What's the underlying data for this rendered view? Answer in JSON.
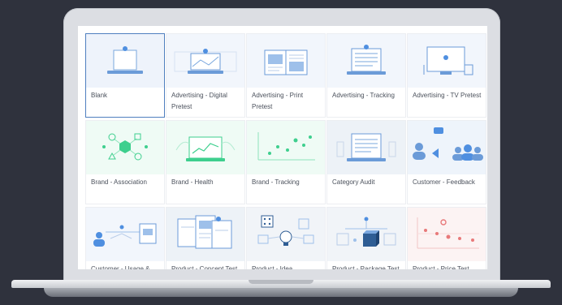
{
  "templates": [
    {
      "label": "Blank",
      "icon": "blank-laptop-icon",
      "bg": "#eef3fb"
    },
    {
      "label": "Advertising - Digital Pretest",
      "icon": "digital-pretest-icon",
      "bg": "#f2f6fc"
    },
    {
      "label": "Advertising - Print Pretest",
      "icon": "print-pretest-icon",
      "bg": "#f2f6fc"
    },
    {
      "label": "Advertising - Tracking",
      "icon": "ad-tracking-icon",
      "bg": "#f2f6fc"
    },
    {
      "label": "Advertising - TV Pretest",
      "icon": "tv-pretest-icon",
      "bg": "#f2f6fc"
    },
    {
      "label": "Brand - Association",
      "icon": "brand-association-icon",
      "bg": "#effbf5"
    },
    {
      "label": "Brand - Health",
      "icon": "brand-health-icon",
      "bg": "#effbf5"
    },
    {
      "label": "Brand - Tracking",
      "icon": "brand-tracking-icon",
      "bg": "#effbf5"
    },
    {
      "label": "Category Audit",
      "icon": "category-audit-icon",
      "bg": "#edf2f7"
    },
    {
      "label": "Customer - Feedback",
      "icon": "customer-feedback-icon",
      "bg": "#eef4fb"
    },
    {
      "label": "Customer - Usage &",
      "icon": "customer-usage-icon",
      "bg": "#f2f6fc"
    },
    {
      "label": "Product - Concept Test",
      "icon": "concept-test-icon",
      "bg": "#edf2f7"
    },
    {
      "label": "Product - Idea Screening",
      "icon": "idea-screening-icon",
      "bg": "#f1f4f8"
    },
    {
      "label": "Product - Package Test",
      "icon": "package-test-icon",
      "bg": "#f1f4f8"
    },
    {
      "label": "Product - Price Test",
      "icon": "price-test-icon",
      "bg": "#fcf3f3"
    }
  ],
  "colors": {
    "accent": "#4f8fe0",
    "green": "#3ecf8e",
    "red": "#e8797a",
    "selected_border": "#4f7fbf"
  }
}
